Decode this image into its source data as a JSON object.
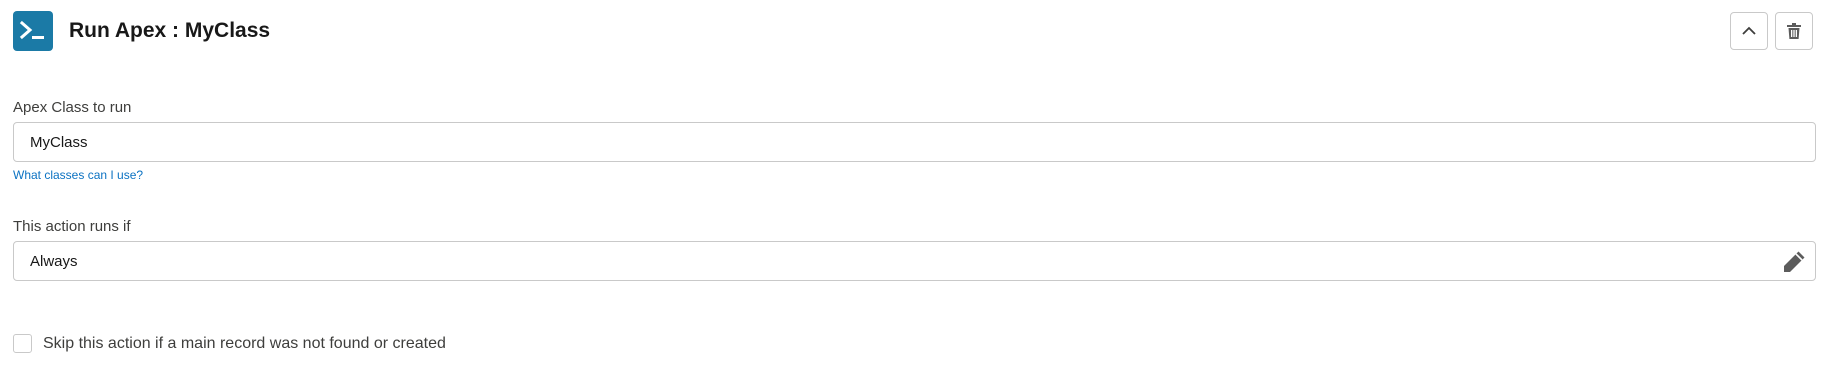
{
  "header": {
    "title": "Run Apex : MyClass",
    "icon": "terminal-icon",
    "icon_bg_color": "#1b7aa6",
    "collapse_icon": "chevron-up-icon",
    "delete_icon": "trash-icon"
  },
  "apex_class": {
    "label": "Apex Class to run",
    "value": "MyClass",
    "help_link": "What classes can I use?"
  },
  "condition": {
    "label": "This action runs if",
    "value": "Always",
    "edit_icon": "pencil-icon"
  },
  "skip_option": {
    "label": "Skip this action if a main record was not found or created",
    "checked": false
  },
  "colors": {
    "link": "#0b72c2",
    "border": "#c9c9c9"
  }
}
